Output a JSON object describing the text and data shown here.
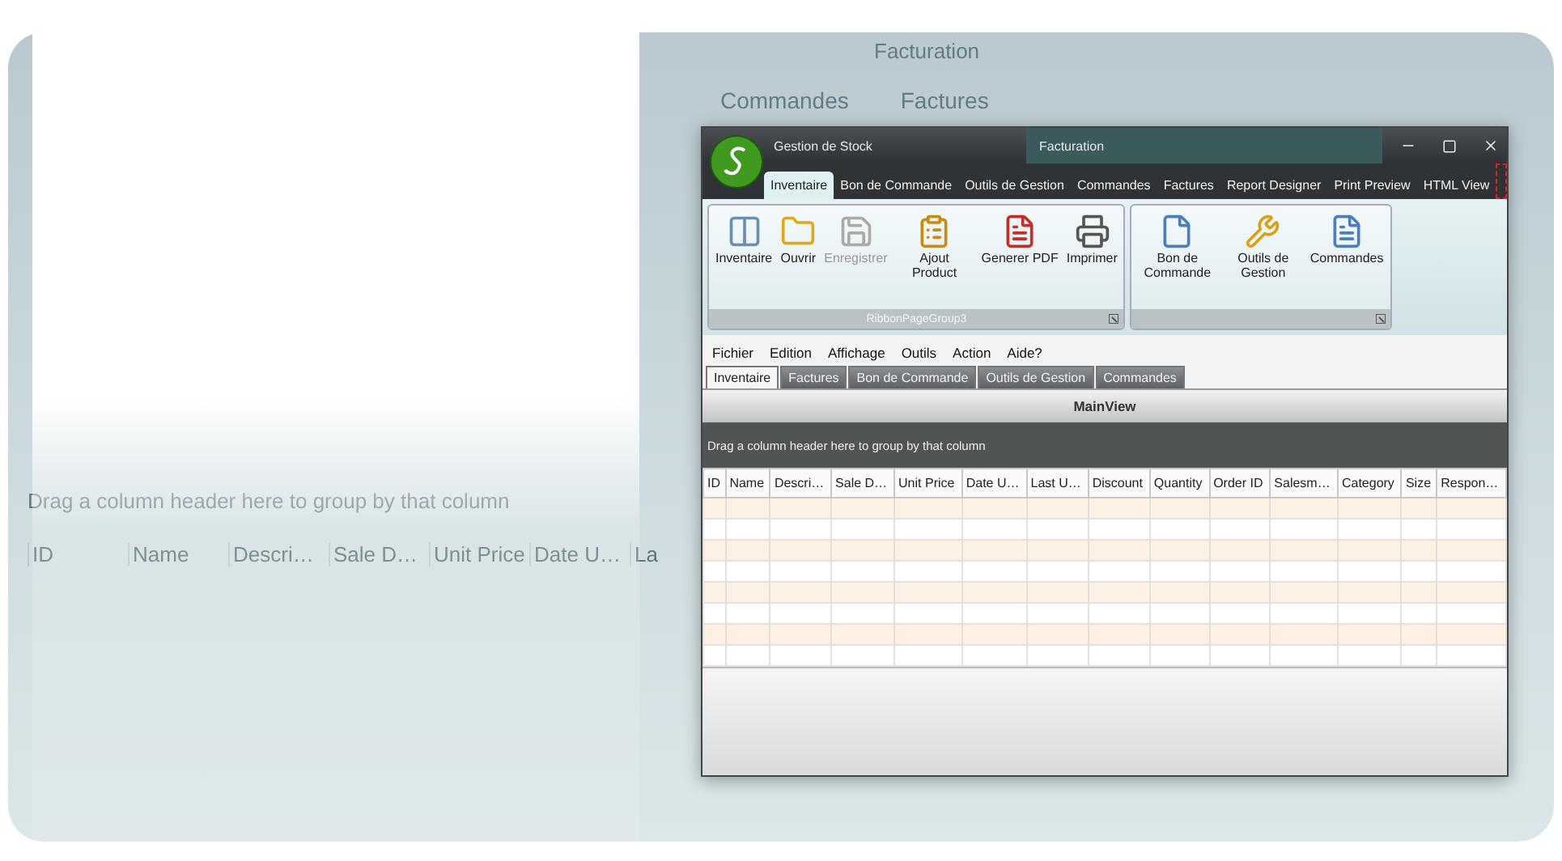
{
  "background_copy": {
    "title": "Facturation",
    "tabs": [
      "Commandes",
      "Factures"
    ],
    "group_panel": "Drag a column header here to group by that column",
    "columns": [
      "ID",
      "Name",
      "Descri…",
      "Sale D…",
      "Unit Price",
      "Date U…",
      "La"
    ]
  },
  "window": {
    "app_title": "Gestion de Stock",
    "context_group": "Facturation"
  },
  "ribbon_tabs": [
    {
      "label": "Inventaire",
      "selected": true
    },
    {
      "label": "Bon de Commande",
      "selected": false
    },
    {
      "label": "Outils de Gestion",
      "selected": false
    },
    {
      "label": "Commandes",
      "selected": false
    },
    {
      "label": "Factures",
      "selected": false
    },
    {
      "label": "Report Designer",
      "selected": false
    },
    {
      "label": "Print Preview",
      "selected": false
    },
    {
      "label": "HTML View",
      "selected": false
    }
  ],
  "ribbon_groups": [
    {
      "caption": "RibbonPageGroup3",
      "buttons": [
        {
          "label": "Inventaire",
          "kind": "columns",
          "disabled": false
        },
        {
          "label": "Ouvrir",
          "kind": "folder",
          "disabled": false
        },
        {
          "label": "Enregistrer",
          "kind": "save",
          "disabled": true
        },
        {
          "label": "Ajout Product",
          "kind": "clipboard",
          "disabled": false
        },
        {
          "label": "Generer PDF",
          "kind": "pdf",
          "disabled": false
        },
        {
          "label": "Imprimer",
          "kind": "printer",
          "disabled": false
        }
      ]
    },
    {
      "buttons": [
        {
          "label": "Bon de Commande",
          "kind": "page",
          "disabled": false
        },
        {
          "label": "Outils de Gestion",
          "kind": "tools",
          "disabled": false
        },
        {
          "label": "Commandes",
          "kind": "document",
          "disabled": false
        }
      ]
    }
  ],
  "menu": [
    "Fichier",
    "Edition",
    "Affichage",
    "Outils",
    "Action",
    "Aide?"
  ],
  "document_tabs": [
    {
      "label": "Inventaire",
      "selected": true
    },
    {
      "label": "Factures",
      "selected": false
    },
    {
      "label": "Bon de Commande",
      "selected": false
    },
    {
      "label": "Outils de Gestion",
      "selected": false
    },
    {
      "label": "Commandes",
      "selected": false
    }
  ],
  "view_title": "MainView",
  "group_panel": "Drag a column header here to group by that column",
  "columns": [
    "ID",
    "Name",
    "Descri…",
    "Sale D…",
    "Unit Price",
    "Date U…",
    "Last U…",
    "Discount",
    "Quantity",
    "Order ID",
    "Salesm…",
    "Category",
    "Size",
    "Respon…"
  ],
  "rows": [
    {
      "kind": "shaded"
    },
    {
      "kind": "plain"
    },
    {
      "kind": "shaded"
    },
    {
      "kind": "plain"
    },
    {
      "kind": "shaded"
    },
    {
      "kind": "plain"
    },
    {
      "kind": "shaded"
    },
    {
      "kind": "plain"
    }
  ]
}
